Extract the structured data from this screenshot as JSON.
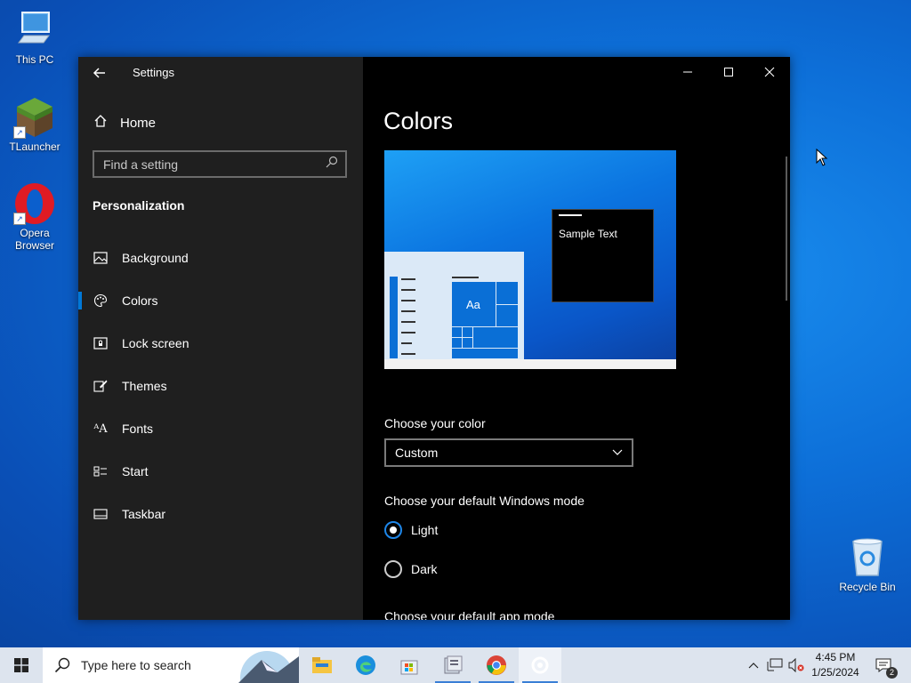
{
  "desktop": {
    "icons": [
      {
        "label": "This PC",
        "icon": "this-pc-icon"
      },
      {
        "label": "TLauncher",
        "icon": "minecraft-block-icon"
      },
      {
        "label": "Opera Browser",
        "icon": "opera-icon"
      },
      {
        "label": "Recycle Bin",
        "icon": "recycle-bin-icon"
      }
    ]
  },
  "window": {
    "title": "Settings",
    "home_label": "Home",
    "search_placeholder": "Find a setting",
    "section": "Personalization",
    "nav": [
      {
        "label": "Background",
        "icon": "picture-icon"
      },
      {
        "label": "Colors",
        "icon": "palette-icon",
        "active": true
      },
      {
        "label": "Lock screen",
        "icon": "lock-screen-icon"
      },
      {
        "label": "Themes",
        "icon": "themes-brush-icon"
      },
      {
        "label": "Fonts",
        "icon": "fonts-icon"
      },
      {
        "label": "Start",
        "icon": "start-icon"
      },
      {
        "label": "Taskbar",
        "icon": "taskbar-icon"
      }
    ],
    "content": {
      "title": "Colors",
      "preview": {
        "sample_text": "Sample Text",
        "tile_text": "Aa"
      },
      "choose_color_label": "Choose your color",
      "choose_color_value": "Custom",
      "windows_mode_label": "Choose your default Windows mode",
      "windows_mode_options": [
        {
          "label": "Light",
          "checked": true
        },
        {
          "label": "Dark",
          "checked": false
        }
      ],
      "app_mode_label": "Choose your default app mode"
    }
  },
  "taskbar": {
    "search_placeholder": "Type here to search",
    "apps": [
      "file-explorer-icon",
      "edge-icon",
      "microsoft-store-icon",
      "control-panel-icon",
      "chrome-icon",
      "settings-icon"
    ],
    "time": "4:45 PM",
    "date": "1/25/2024",
    "notification_count": "2"
  },
  "colors": {
    "accent": "#0078d7",
    "sidebar": "#1f1f1f",
    "content": "#000000"
  }
}
